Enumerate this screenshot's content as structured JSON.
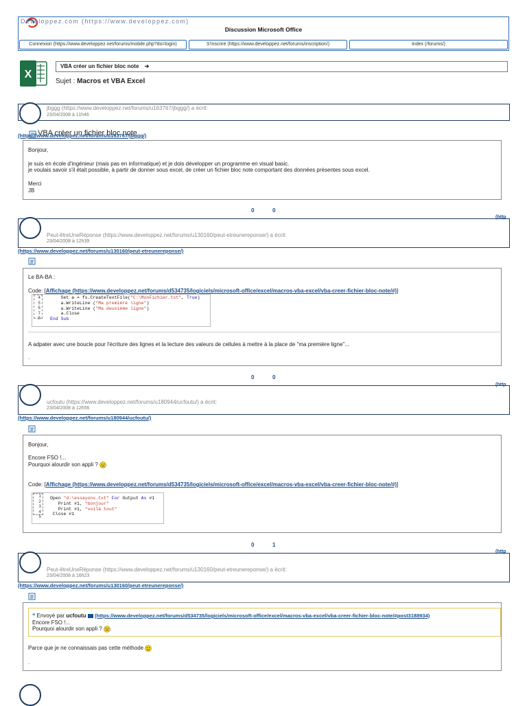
{
  "header": {
    "site_title": "Developpez.com (https://www.developpez.com)",
    "discussion_title": "Discussion Microsoft Office",
    "nav": [
      {
        "label": "Connexion (https://www.developpez.net/forums/mobile.php?do=login)"
      },
      {
        "label": "S'inscrire (https://www.developpez.net/forums/inscription/)"
      },
      {
        "label": "Index (/forums/)"
      }
    ]
  },
  "topic": {
    "title": "VBA créer un fichier bloc note",
    "arrow": "➔",
    "subject_label": "Sujet : ",
    "subject_value": "Macros et VBA Excel"
  },
  "posts": [
    {
      "author_line": "jbggg (https://www.developpez.net/forums/u163767/jbggg/) a écrit:",
      "date": "23/04/2008 à 11h46",
      "author_link": "(https://www.developpez.net/forums/u163767/jbggg/)",
      "post_title": "VBA créer un fichier bloc note",
      "lines": [
        "Bonjour,",
        "je suis en école d'ingénieur (mais pas en informatique) et je dois développer un programme en visual basic.",
        "je voulais savoir s'il était possible, à partir de donner sous excel, de créer un fichier bloc note comportant des données présentes sous excel.",
        "Merci",
        "JB"
      ],
      "votes_up": "0",
      "votes_down": "0",
      "edge_text": "(http"
    },
    {
      "author_line": "Peut-êtreUneRéponse (https://www.developpez.net/forums/u130160/peut-etreunereponse/) a écrit:",
      "date": "23/04/2008 à 12h39",
      "author_link": "(https://www.developpez.net/forums/u130160/peut-etreunereponse/)",
      "intro": "Le BA-BA :",
      "code_label": "Code: [",
      "code_link": "Affichage (https://www.developpez.net/forums/d534735/logiciels/microsoft-office/excel/macros-vba-excel/vba-creer-fichier-bloc-note/#)",
      "code_close": "]",
      "line_numbers": [
        "4",
        "5",
        "6",
        "7",
        "8"
      ],
      "text_after": "A adpater avec une boucle pour l'écriture des lignes et la lecture des valeurs de cellules à mettre à la place de \"ma première ligne\"...",
      "dot": ".",
      "votes_up": "0",
      "votes_down": "0",
      "edge_text": "(http"
    },
    {
      "author_line": "ucfoutu (https://www.developpez.net/forums/u180944/ucfoutu/) a écrit:",
      "date": "23/04/2008 à 12h56",
      "author_link": "(https://www.developpez.net/forums/u180944/ucfoutu/)",
      "lines": [
        "Bonjour,",
        "Encore FSO !...",
        "Pourquoi alourdir son appli ?"
      ],
      "code_label": "Code: [",
      "code_link": "Affichage (https://www.developpez.net/forums/d534735/logiciels/microsoft-office/excel/macros-vba-excel/vba-creer-fichier-bloc-note/#)",
      "code_close": "]",
      "line_numbers": [
        "1",
        "2",
        "3",
        "4",
        "5"
      ],
      "votes_up": "0",
      "votes_down": "1",
      "edge_text": "(http"
    },
    {
      "author_line": "Peut-êtreUneRéponse (https://www.developpez.net/forums/u130160/peut-etreunereponse/) a écrit:",
      "date": "23/04/2008 à 16h23",
      "author_link": "(https://www.developpez.net/forums/u130160/peut-etreunereponse/)",
      "quote_prefix": "Envoyé par ",
      "quote_author": "ucfoutu",
      "quote_link": "(https://www.developpez.net/forums/d534735/logiciels/microsoft-office/excel/macros-vba-excel/vba-creer-fichier-bloc-note/#post3188934)",
      "quote_lines": [
        "Encore FSO !...",
        "Pourquoi alourdir son appli ?"
      ],
      "reply": "Parce que je ne connaissais pas cette méthode",
      "dot": "."
    }
  ],
  "colors": {
    "accent": "#2a6db3",
    "link": "#1a4f8b",
    "avatar_border": "#1e3a5f",
    "quote_border": "#e7c65a",
    "excel_green": "#1e7145"
  },
  "icons": [
    "developpez-logo-icon",
    "excel-icon",
    "arrow-right-icon",
    "message-icon",
    "quote-icon",
    "post-link-icon",
    "smiley-icon"
  ]
}
